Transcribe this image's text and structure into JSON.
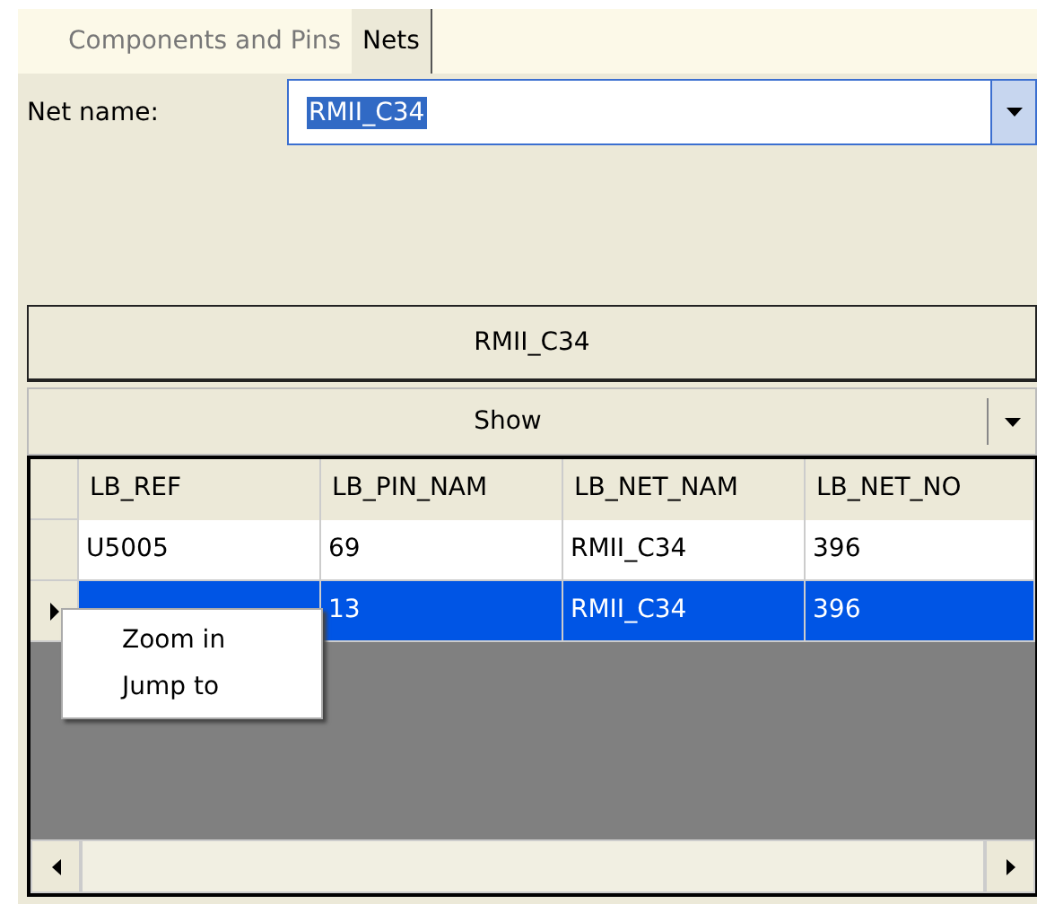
{
  "tabs": [
    {
      "label": "Components and Pins",
      "selected": false
    },
    {
      "label": "Nets",
      "selected": true
    }
  ],
  "net_name": {
    "label": "Net name:",
    "value": "RMII_C34"
  },
  "net_button": "RMII_C34",
  "show_dropdown": "Show",
  "grid": {
    "columns": [
      "LB_REF",
      "LB_PIN_NAM",
      "LB_NET_NAM",
      "LB_NET_NO"
    ],
    "rows": [
      {
        "cells": [
          "U5005",
          "69",
          "RMII_C34",
          "396"
        ],
        "selected": false,
        "current": false
      },
      {
        "cells": [
          "",
          "13",
          "RMII_C34",
          "396"
        ],
        "selected": true,
        "current": true
      }
    ]
  },
  "context_menu": [
    "Zoom in",
    "Jump to"
  ]
}
